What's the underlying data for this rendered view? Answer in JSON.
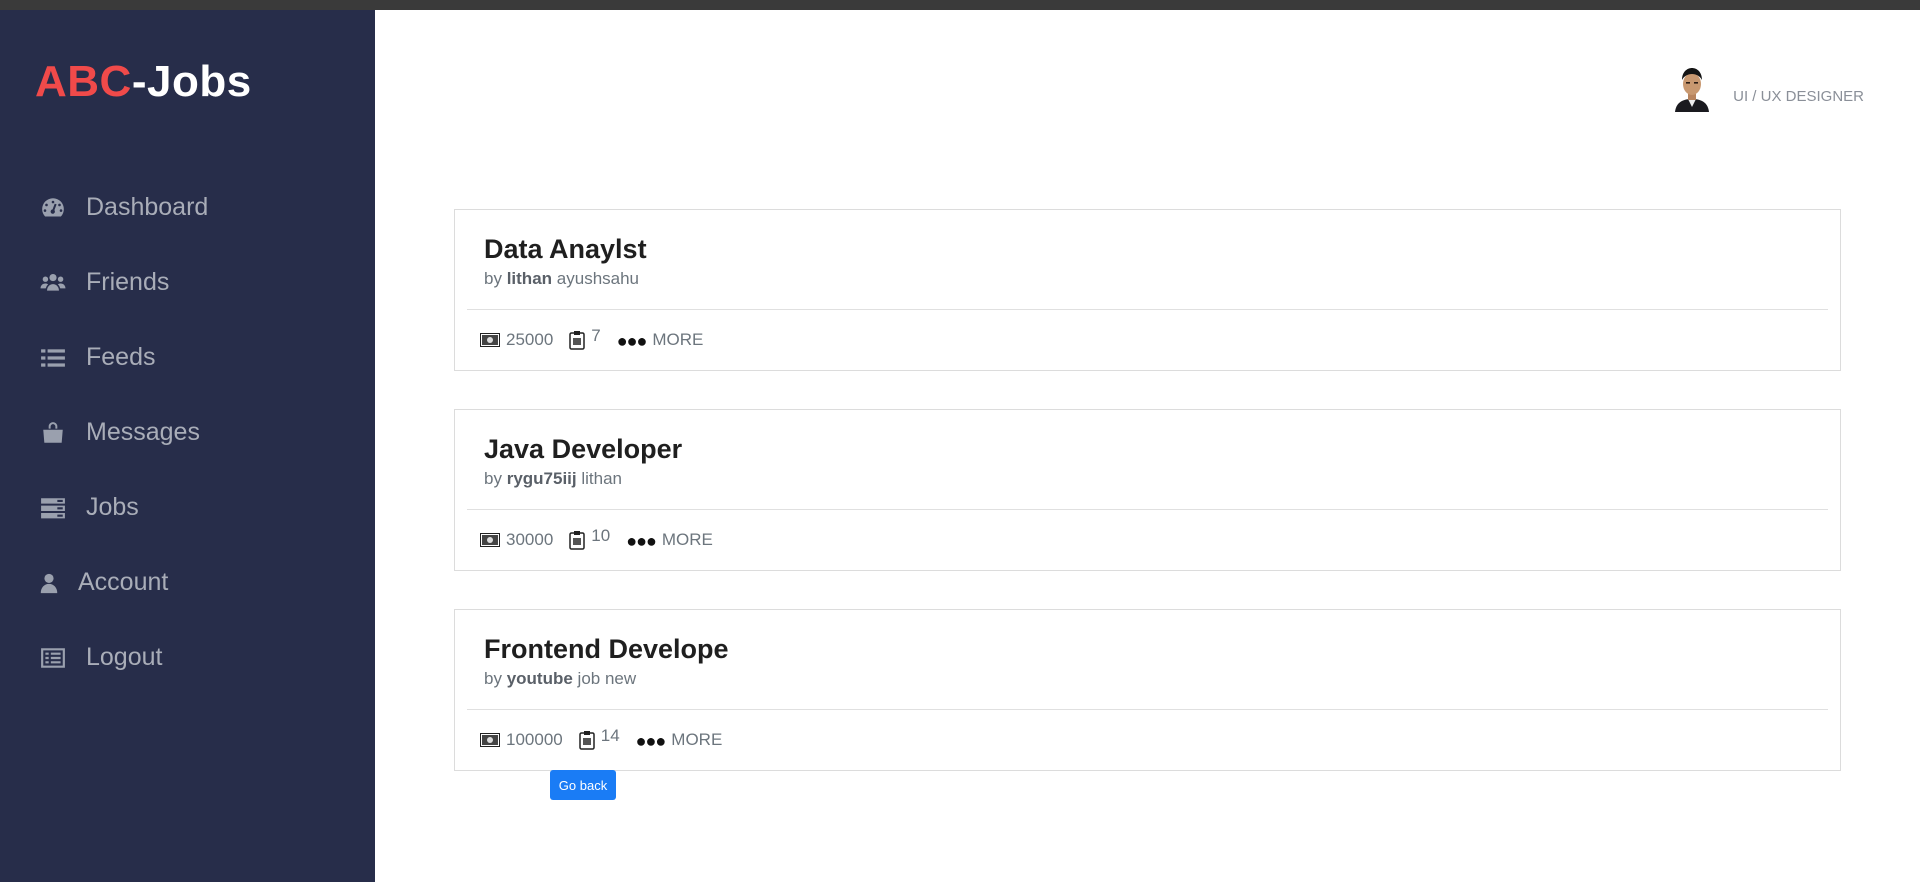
{
  "brand": {
    "part1": "ABC",
    "part2": "-Jobs"
  },
  "nav": [
    {
      "label": "Dashboard",
      "icon": "dashboard-icon"
    },
    {
      "label": "Friends",
      "icon": "users-icon"
    },
    {
      "label": "Feeds",
      "icon": "list-icon"
    },
    {
      "label": "Messages",
      "icon": "shopping-bag-icon"
    },
    {
      "label": "Jobs",
      "icon": "server-icon"
    },
    {
      "label": "Account",
      "icon": "user-icon"
    },
    {
      "label": "Logout",
      "icon": "logout-icon"
    }
  ],
  "profile": {
    "role": "UI / UX DESIGNER"
  },
  "jobs": [
    {
      "title": "Data Anaylst",
      "by": "by",
      "author": "lithan",
      "company": "ayushsahu",
      "salary": "25000",
      "count": "7",
      "more": "MORE"
    },
    {
      "title": "Java Developer",
      "by": "by",
      "author": "rygu75iij",
      "company": "lithan",
      "salary": "30000",
      "count": "10",
      "more": "MORE"
    },
    {
      "title": "Frontend Develope",
      "by": "by",
      "author": "youtube",
      "company": "job new",
      "salary": "100000",
      "count": "14",
      "more": "MORE"
    }
  ],
  "actions": {
    "go_back": "Go back"
  },
  "colors": {
    "sidebar": "#272d4a",
    "brand_accent": "#f04a4a",
    "primary_button": "#1a7cf5"
  }
}
